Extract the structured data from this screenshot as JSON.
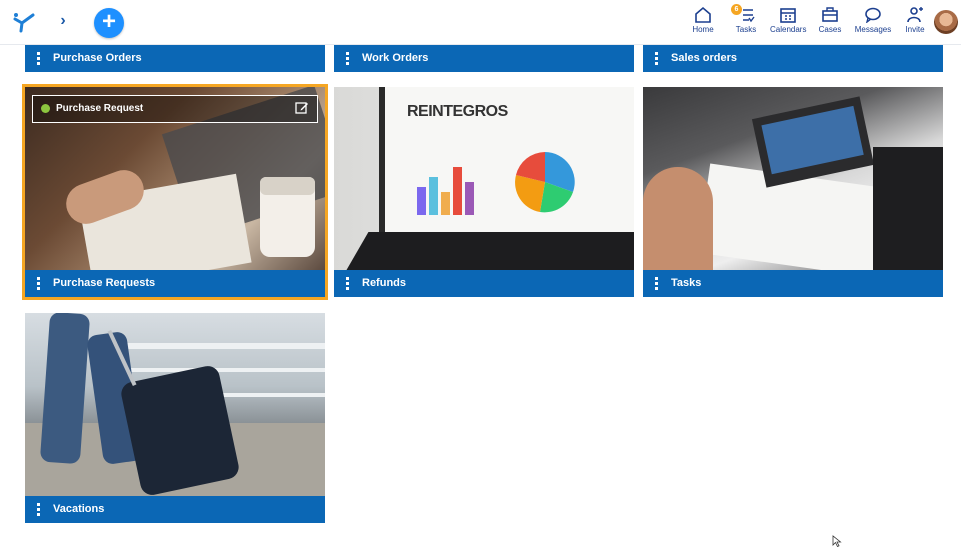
{
  "topnav": {
    "items": [
      {
        "label": "Home"
      },
      {
        "label": "Tasks",
        "badge": "6"
      },
      {
        "label": "Calendars"
      },
      {
        "label": "Cases"
      },
      {
        "label": "Messages"
      },
      {
        "label": "Invite"
      }
    ]
  },
  "cards": [
    {
      "title": "Purchase Orders"
    },
    {
      "title": "Work Orders"
    },
    {
      "title": "Sales orders"
    },
    {
      "title": "Purchase Requests",
      "overlay": "Purchase Request"
    },
    {
      "title": "Refunds",
      "image_text": "REINTEGROS"
    },
    {
      "title": "Tasks"
    },
    {
      "title": "Vacations"
    }
  ],
  "colors": {
    "bar": "#0b67b5",
    "accent": "#1e90ff",
    "selection": "#f5a623",
    "status_dot": "#8dc63f",
    "nav_icon": "#1c3f8f"
  }
}
